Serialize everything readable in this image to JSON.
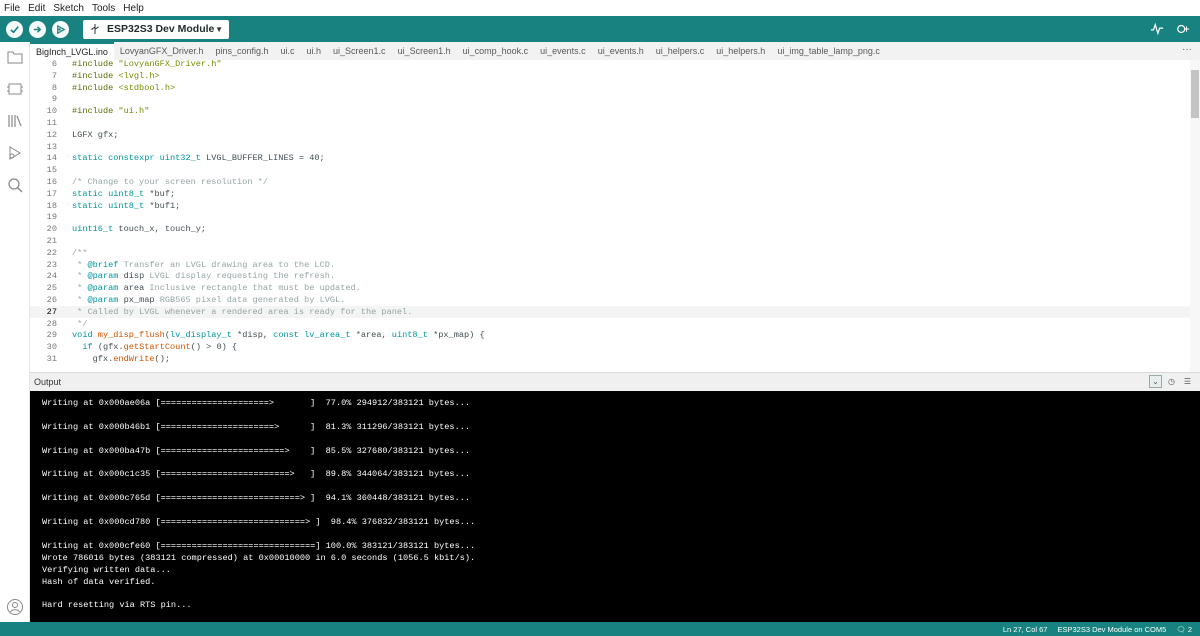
{
  "menu": [
    "File",
    "Edit",
    "Sketch",
    "Tools",
    "Help"
  ],
  "toolbar": {
    "board_name": "ESP32S3 Dev Module",
    "verify_icon": "check-icon",
    "upload_icon": "arrow-right-icon",
    "debug_icon": "debugger-icon",
    "serial_plotter_icon": "plotter-icon",
    "serial_monitor_icon": "serial-monitor-icon"
  },
  "tabs": [
    {
      "label": "BigInch_LVGL.ino",
      "active": true
    },
    {
      "label": "LovyanGFX_Driver.h"
    },
    {
      "label": "pins_config.h"
    },
    {
      "label": "ui.c"
    },
    {
      "label": "ui.h"
    },
    {
      "label": "ui_Screen1.c"
    },
    {
      "label": "ui_Screen1.h"
    },
    {
      "label": "ui_comp_hook.c"
    },
    {
      "label": "ui_events.c"
    },
    {
      "label": "ui_events.h"
    },
    {
      "label": "ui_helpers.c"
    },
    {
      "label": "ui_helpers.h"
    },
    {
      "label": "ui_img_table_lamp_png.c"
    }
  ],
  "tabs_more": "···",
  "editor": {
    "current_line": 27,
    "lines": [
      {
        "n": "6",
        "segs": [
          [
            "pp",
            "#include "
          ],
          [
            "tag",
            "\"LovyanGFX_Driver.h\""
          ]
        ]
      },
      {
        "n": "7",
        "segs": [
          [
            "pp",
            "#include "
          ],
          [
            "tag",
            "<lvgl.h>"
          ]
        ]
      },
      {
        "n": "8",
        "segs": [
          [
            "pp",
            "#include "
          ],
          [
            "tag",
            "<stdbool.h>"
          ]
        ]
      },
      {
        "n": "9",
        "segs": []
      },
      {
        "n": "10",
        "segs": [
          [
            "pp",
            "#include "
          ],
          [
            "tag",
            "\"ui.h\""
          ]
        ]
      },
      {
        "n": "11",
        "segs": []
      },
      {
        "n": "12",
        "segs": [
          [
            "plain",
            "LGFX gfx;"
          ]
        ]
      },
      {
        "n": "13",
        "segs": []
      },
      {
        "n": "14",
        "segs": [
          [
            "kw",
            "static constexpr uint32_t "
          ],
          [
            "plain",
            "LVGL_BUFFER_LINES = 40;"
          ]
        ]
      },
      {
        "n": "15",
        "segs": []
      },
      {
        "n": "16",
        "segs": [
          [
            "cm",
            "/* Change to your screen resolution */"
          ]
        ]
      },
      {
        "n": "17",
        "segs": [
          [
            "kw",
            "static uint8_t "
          ],
          [
            "plain",
            "*buf;"
          ]
        ]
      },
      {
        "n": "18",
        "segs": [
          [
            "kw",
            "static uint8_t "
          ],
          [
            "plain",
            "*buf1;"
          ]
        ]
      },
      {
        "n": "19",
        "segs": []
      },
      {
        "n": "20",
        "segs": [
          [
            "kw",
            "uint16_t "
          ],
          [
            "plain",
            "touch_x, touch_y;"
          ]
        ]
      },
      {
        "n": "21",
        "segs": []
      },
      {
        "n": "22",
        "segs": [
          [
            "cm",
            "/**"
          ]
        ]
      },
      {
        "n": "23",
        "segs": [
          [
            "cm",
            " * "
          ],
          [
            "kw",
            "@brief"
          ],
          [
            "cm",
            " Transfer an LVGL drawing area to the LCD."
          ]
        ]
      },
      {
        "n": "24",
        "segs": [
          [
            "cm",
            " * "
          ],
          [
            "kw",
            "@param"
          ],
          [
            "plain",
            " disp"
          ],
          [
            "cm",
            " LVGL display requesting the refresh."
          ]
        ]
      },
      {
        "n": "25",
        "segs": [
          [
            "cm",
            " * "
          ],
          [
            "kw",
            "@param"
          ],
          [
            "plain",
            " area"
          ],
          [
            "cm",
            " Inclusive rectangle that must be updated."
          ]
        ]
      },
      {
        "n": "26",
        "segs": [
          [
            "cm",
            " * "
          ],
          [
            "kw",
            "@param"
          ],
          [
            "plain",
            " px_map"
          ],
          [
            "cm",
            " RGB565 pixel data generated by LVGL."
          ]
        ]
      },
      {
        "n": "27",
        "segs": [
          [
            "cm",
            " * Called by LVGL whenever a rendered area is ready for the panel."
          ]
        ]
      },
      {
        "n": "28",
        "segs": [
          [
            "cm",
            " */"
          ]
        ]
      },
      {
        "n": "29",
        "segs": [
          [
            "kw",
            "void "
          ],
          [
            "fn",
            "my_disp_flush"
          ],
          [
            "plain",
            "("
          ],
          [
            "kw",
            "lv_display_t "
          ],
          [
            "plain",
            "*disp, "
          ],
          [
            "kw",
            "const lv_area_t "
          ],
          [
            "plain",
            "*area, "
          ],
          [
            "kw",
            "uint8_t "
          ],
          [
            "plain",
            "*px_map) {"
          ]
        ]
      },
      {
        "n": "30",
        "segs": [
          [
            "plain",
            "  "
          ],
          [
            "kw",
            "if "
          ],
          [
            "plain",
            "(gfx."
          ],
          [
            "fn",
            "getStartCount"
          ],
          [
            "plain",
            "() > 0) {"
          ]
        ]
      },
      {
        "n": "31",
        "segs": [
          [
            "plain",
            "    gfx."
          ],
          [
            "fn",
            "endWrite"
          ],
          [
            "plain",
            "();"
          ]
        ]
      }
    ]
  },
  "output": {
    "title": "Output",
    "lines": [
      "Writing at 0x000ae06a [=====================>       ]  77.0% 294912/383121 bytes...",
      "",
      "Writing at 0x000b46b1 [======================>      ]  81.3% 311296/383121 bytes...",
      "",
      "Writing at 0x000ba47b [========================>    ]  85.5% 327680/383121 bytes...",
      "",
      "Writing at 0x000c1c35 [=========================>   ]  89.8% 344064/383121 bytes...",
      "",
      "Writing at 0x000c765d [===========================> ]  94.1% 360448/383121 bytes...",
      "",
      "Writing at 0x000cd780 [============================> ]  98.4% 376832/383121 bytes...",
      "",
      "Writing at 0x000cfe60 [==============================] 100.0% 383121/383121 bytes...",
      "Wrote 786016 bytes (383121 compressed) at 0x00010000 in 6.0 seconds (1056.5 kbit/s).",
      "Verifying written data...",
      "Hash of data verified.",
      "",
      "Hard resetting via RTS pin..."
    ]
  },
  "status": {
    "position": "Ln 27, Col 67",
    "board": "ESP32S3 Dev Module on COM5",
    "notifications": "2"
  }
}
